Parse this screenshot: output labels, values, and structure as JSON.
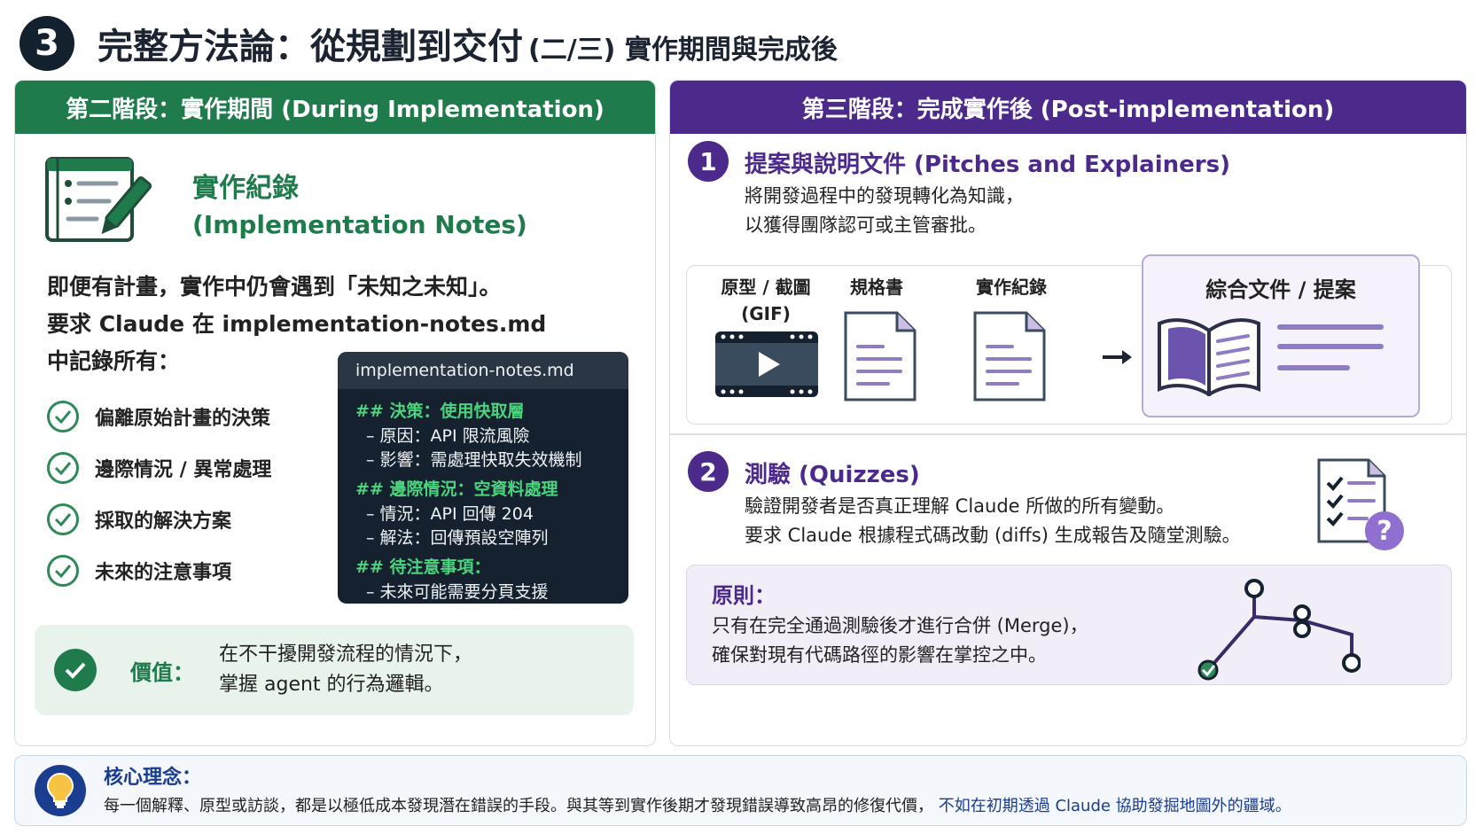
{
  "title": {
    "number": "3",
    "main": "完整方法論：從規劃到交付",
    "sub": "(二/三) 實作期間與完成後"
  },
  "left": {
    "header": "第二階段：實作期間 (During Implementation)",
    "notes_title": "實作紀錄",
    "notes_subtitle": "(Implementation Notes)",
    "intro": [
      "即便有計畫，實作中仍會遇到「未知之未知」。",
      "要求 Claude 在 implementation-notes.md",
      "中記錄所有："
    ],
    "checklist": [
      "偏離原始計畫的決策",
      "邊際情況 / 異常處理",
      "採取的解決方案",
      "未來的注意事項"
    ],
    "code": {
      "filename": "implementation-notes.md",
      "sections": [
        {
          "h": "## 決策：使用快取層",
          "lines": [
            "– 原因：API 限流風險",
            "– 影響：需處理快取失效機制"
          ]
        },
        {
          "h": "## 邊際情況：空資料處理",
          "lines": [
            "– 情況：API 回傳 204",
            "– 解法：回傳預設空陣列"
          ]
        },
        {
          "h": "## 待注意事項：",
          "lines": [
            "– 未來可能需要分頁支援"
          ]
        }
      ]
    },
    "value": {
      "label": "價值：",
      "lines": [
        "在不干擾開發流程的情況下，",
        "掌握 agent 的行為邏輯。"
      ]
    }
  },
  "right": {
    "header": "第三階段：完成實作後 (Post-implementation)",
    "pitches": {
      "number": "1",
      "title": "提案與說明文件 (Pitches and Explainers)",
      "desc": [
        "將開發過程中的發現轉化為知識，",
        "以獲得團隊認可或主管審批。"
      ],
      "flow": {
        "prototype_l1": "原型 / 截圖",
        "prototype_l2": "(GIF)",
        "spec": "規格書",
        "notes": "實作紀錄",
        "synth": "綜合文件 / 提案"
      }
    },
    "quizzes": {
      "number": "2",
      "title": "測驗 (Quizzes)",
      "desc": [
        "驗證開發者是否真正理解 Claude 所做的所有變動。",
        "要求 Claude 根據程式碼改動 (diffs) 生成報告及隨堂測驗。"
      ]
    },
    "principle": {
      "title": "原則：",
      "lines": [
        "只有在完全通過測驗後才進行合併 (Merge)，",
        "確保對現有代碼路徑的影響在掌控之中。"
      ]
    }
  },
  "core": {
    "title": "核心理念：",
    "text": "每一個解釋、原型或訪談，都是以極低成本發現潛在錯誤的手段。與其等到實作後期才發現錯誤導致高昂的修復代價，",
    "highlight": " 不如在初期透過 Claude 協助發掘地圖外的疆域。"
  },
  "colors": {
    "green": "#1f7a4c",
    "purple": "#4b2a8c",
    "navy": "#13202e",
    "blue": "#1a3d8f"
  }
}
